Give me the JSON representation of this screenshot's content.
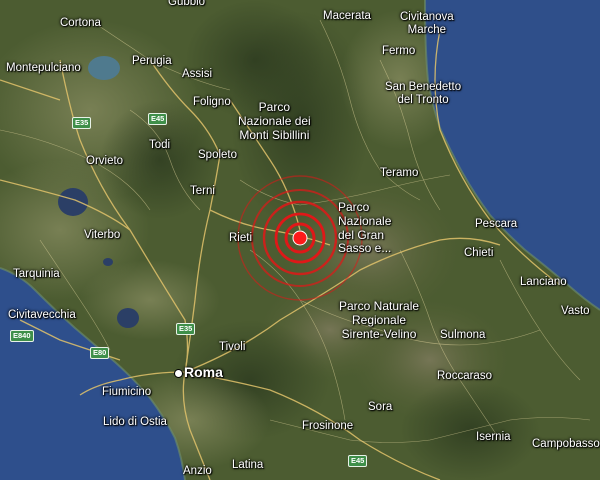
{
  "map": {
    "type": "satellite terrain",
    "colors": {
      "sea": "#2f4f8a",
      "land": "#4e5f34",
      "mountain": "#6b6b4e",
      "road": "#e2c36b",
      "rings": "#e01818",
      "epicenter": "#ff1a1a"
    },
    "epicenter_marker": {
      "rings": 5,
      "icon": "epicenter-dot-icon"
    }
  },
  "places": {
    "gubbio": "Gubbio",
    "macerata": "Macerata",
    "civitanova": "Civitanova\nMarche",
    "cortona": "Cortona",
    "fermo": "Fermo",
    "perugia": "Perugia",
    "assisi": "Assisi",
    "montepulciano": "Montepulciano",
    "san_benedetto": "San Benedetto\ndel Tronto",
    "foligno": "Foligno",
    "sibillini": "Parco\nNazionale dei\nMonti Sibillini",
    "todi": "Todi",
    "spoleto": "Spoleto",
    "orvieto": "Orvieto",
    "teramo": "Teramo",
    "terni": "Terni",
    "gran_sasso": "Parco\nNazionale\ndel Gran\nSasso e...",
    "pescara": "Pescara",
    "viterbo": "Viterbo",
    "rieti": "Rieti",
    "chieti": "Chieti",
    "tarquinia": "Tarquinia",
    "lanciano": "Lanciano",
    "sirente": "Parco Naturale\nRegionale\nSirente-Velino",
    "civitavecchia": "Civitavecchia",
    "vasto": "Vasto",
    "sulmona": "Sulmona",
    "tivoli": "Tivoli",
    "roma": "Roma",
    "roccaraso": "Roccaraso",
    "fiumicino": "Fiumicino",
    "sora": "Sora",
    "lido_ostia": "Lido di Ostia",
    "frosinone": "Frosinone",
    "isernia": "Isernia",
    "campobasso": "Campobasso",
    "anzio": "Anzio",
    "latina": "Latina"
  },
  "roads": {
    "e35_north": "E35",
    "e45": "E45",
    "e35_south": "E35",
    "e840": "E840",
    "e80": "E80",
    "e45_south": "E45"
  }
}
